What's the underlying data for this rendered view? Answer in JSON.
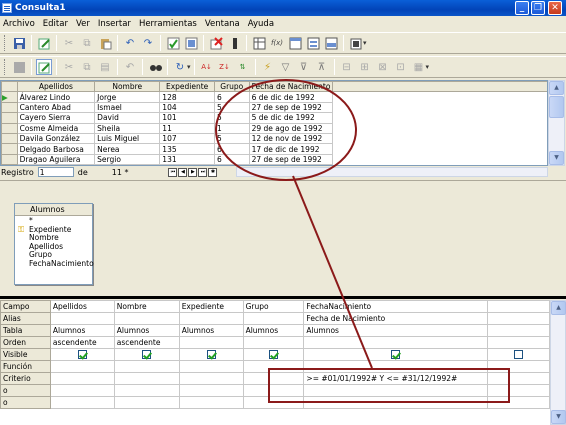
{
  "window": {
    "title": "Consulta1",
    "minimize": "_",
    "maximize": "❐",
    "close": "✕"
  },
  "menu": [
    "Archivo",
    "Editar",
    "Ver",
    "Insertar",
    "Herramientas",
    "Ventana",
    "Ayuda"
  ],
  "grid": {
    "columns": [
      "Apellidos",
      "Nombre",
      "Expediente",
      "Grupo",
      "Fecha de Nacimiento"
    ],
    "rows": [
      [
        "Álvarez Lindo",
        "Jorge",
        "128",
        "6",
        "6 de dic de 1992"
      ],
      [
        "Cantero Abad",
        "Ismael",
        "104",
        "5",
        "27 de sep de 1992"
      ],
      [
        "Cayero Sierra",
        "David",
        "101",
        "5",
        "5 de dic de 1992"
      ],
      [
        "Cosme Almeida",
        "Sheila",
        "11",
        "1",
        "29 de ago de 1992"
      ],
      [
        "Davila González",
        "Luis Miguel",
        "107",
        "5",
        "12 de nov de 1992"
      ],
      [
        "Delgado Barbosa",
        "Nerea",
        "135",
        "6",
        "17 de dic de 1992"
      ],
      [
        "Dragao Aguilera",
        "Sergio",
        "131",
        "6",
        "27 de sep de 1992"
      ]
    ],
    "current_row_marker": "▶"
  },
  "navigator": {
    "label": "Registro",
    "record": "1",
    "of_label": "de",
    "total": "11 *"
  },
  "table_box": {
    "title": "Alumnos",
    "fields": [
      "*",
      "Expediente",
      "Nombre",
      "Apellidos",
      "Grupo",
      "FechaNacimiento"
    ]
  },
  "design": {
    "row_labels": [
      "Campo",
      "Alias",
      "Tabla",
      "Orden",
      "Visible",
      "Función",
      "Criterio",
      "o",
      "o"
    ],
    "columns": [
      {
        "campo": "Apellidos",
        "alias": "",
        "tabla": "Alumnos",
        "orden": "ascendente",
        "visible": true,
        "criterio": ""
      },
      {
        "campo": "Nombre",
        "alias": "",
        "tabla": "Alumnos",
        "orden": "ascendente",
        "visible": true,
        "criterio": ""
      },
      {
        "campo": "Expediente",
        "alias": "",
        "tabla": "Alumnos",
        "orden": "",
        "visible": true,
        "criterio": ""
      },
      {
        "campo": "Grupo",
        "alias": "",
        "tabla": "Alumnos",
        "orden": "",
        "visible": true,
        "criterio": ""
      },
      {
        "campo": "FechaNacimiento",
        "alias": "Fecha de Nacimiento",
        "tabla": "Alumnos",
        "orden": "",
        "visible": true,
        "criterio": ">= #01/01/1992# Y <= #31/12/1992#"
      },
      {
        "campo": "",
        "alias": "",
        "tabla": "",
        "orden": "",
        "visible": false,
        "criterio": ""
      }
    ]
  },
  "colors": {
    "annotation": "#8b1a1a",
    "titlebar": "#0a5fd8"
  }
}
